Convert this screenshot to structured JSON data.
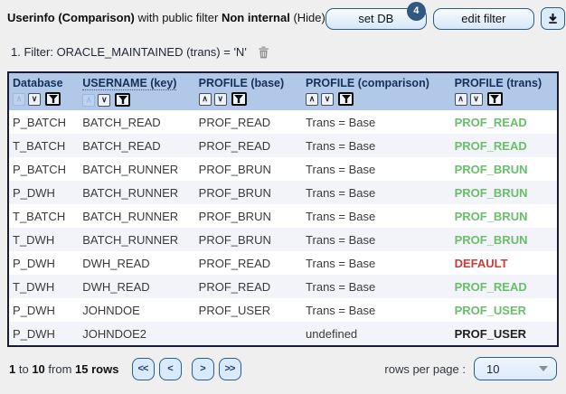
{
  "header": {
    "title_bold": "Userinfo (Comparison)",
    "title_mid": "with public filter",
    "filter_name": "Non internal",
    "hide_label": "(Hide)",
    "set_db_label": "set DB",
    "db_count": "4",
    "edit_filter_label": "edit filter"
  },
  "icons": {
    "download": "download-icon",
    "refresh": "refresh-icon",
    "delete_filter": "trash-icon",
    "sort_asc": "chevron-up-icon",
    "sort_desc": "chevron-down-icon",
    "filter": "funnel-icon",
    "dropdown": "caret-down-icon"
  },
  "colors": {
    "accent_blue": "#2b5c8a",
    "header_bg": "#b2c8e8",
    "badge_bg": "#33587f",
    "trans_green": "#68c168",
    "trans_red": "#d03b37"
  },
  "filter_row": {
    "text": "1. Filter: ORACLE_MAINTAINED (trans) = 'N'"
  },
  "table": {
    "sort_asc_glyph": "∧",
    "sort_desc_glyph": "∨",
    "columns": [
      {
        "label": "Database",
        "dim_asc": true,
        "key": false
      },
      {
        "label": "USERNAME (key)",
        "dim_asc": true,
        "key": true
      },
      {
        "label": "PROFILE (base)",
        "dim_asc": false,
        "key": false
      },
      {
        "label": "PROFILE (comparison)",
        "dim_asc": false,
        "key": false
      },
      {
        "label": "PROFILE (trans)",
        "dim_asc": false,
        "key": false
      }
    ],
    "rows": [
      {
        "database": "P_BATCH",
        "username": "BATCH_READ",
        "profile_base": "PROF_READ",
        "profile_comparison": "Trans = Base",
        "profile_trans": "PROF_READ",
        "trans_style": "green"
      },
      {
        "database": "T_BATCH",
        "username": "BATCH_READ",
        "profile_base": "PROF_READ",
        "profile_comparison": "Trans = Base",
        "profile_trans": "PROF_READ",
        "trans_style": "green"
      },
      {
        "database": "P_BATCH",
        "username": "BATCH_RUNNER",
        "profile_base": "PROF_BRUN",
        "profile_comparison": "Trans = Base",
        "profile_trans": "PROF_BRUN",
        "trans_style": "green"
      },
      {
        "database": "P_DWH",
        "username": "BATCH_RUNNER",
        "profile_base": "PROF_BRUN",
        "profile_comparison": "Trans = Base",
        "profile_trans": "PROF_BRUN",
        "trans_style": "green"
      },
      {
        "database": "T_BATCH",
        "username": "BATCH_RUNNER",
        "profile_base": "PROF_BRUN",
        "profile_comparison": "Trans = Base",
        "profile_trans": "PROF_BRUN",
        "trans_style": "green"
      },
      {
        "database": "T_DWH",
        "username": "BATCH_RUNNER",
        "profile_base": "PROF_BRUN",
        "profile_comparison": "Trans = Base",
        "profile_trans": "PROF_BRUN",
        "trans_style": "green"
      },
      {
        "database": "P_DWH",
        "username": "DWH_READ",
        "profile_base": "PROF_READ",
        "profile_comparison": "Trans = Base",
        "profile_trans": "DEFAULT",
        "trans_style": "red"
      },
      {
        "database": "T_DWH",
        "username": "DWH_READ",
        "profile_base": "PROF_READ",
        "profile_comparison": "Trans = Base",
        "profile_trans": "PROF_READ",
        "trans_style": "green"
      },
      {
        "database": "P_DWH",
        "username": "JOHNDOE",
        "profile_base": "PROF_USER",
        "profile_comparison": "Trans = Base",
        "profile_trans": "PROF_USER",
        "trans_style": "green"
      },
      {
        "database": "P_DWH",
        "username": "JOHNDOE2",
        "profile_base": "",
        "profile_comparison": "undefined",
        "profile_trans": "PROF_USER",
        "trans_style": "dark"
      }
    ]
  },
  "footer": {
    "range_start": "1",
    "to_word": "to",
    "range_end": "10",
    "from_word": "from",
    "total_bold": "15 rows",
    "pager_first": "<<",
    "pager_prev": "<",
    "pager_next": ">",
    "pager_last": ">>",
    "rows_per_page_label": "rows per page :",
    "rows_per_page_value": "10"
  }
}
